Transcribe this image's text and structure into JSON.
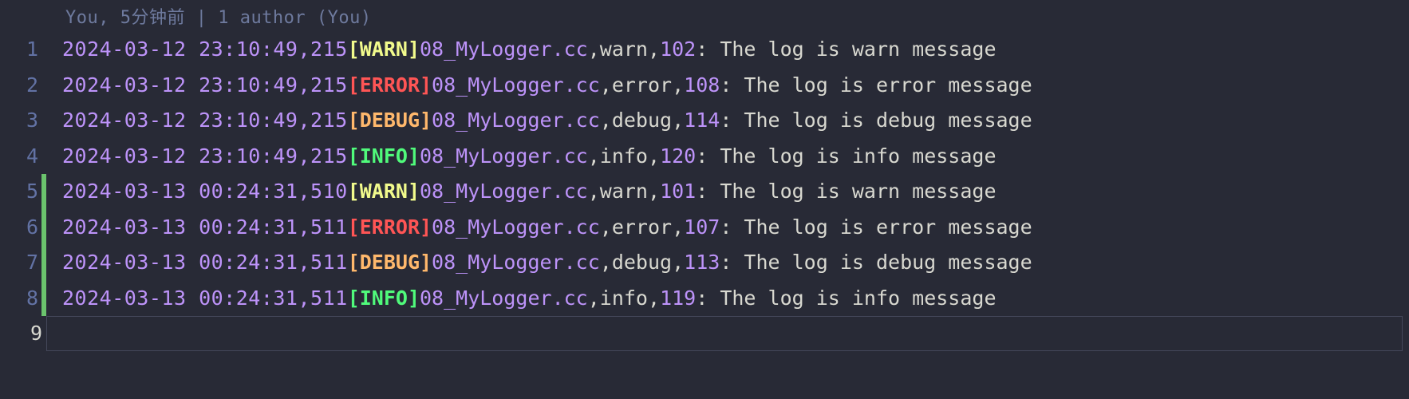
{
  "codelens": "You, 5分钟前 | 1 author (You)",
  "current_line_number": "9",
  "lines": [
    {
      "num": "1",
      "modified": false,
      "date": "2024-03-12 23:10:49,215",
      "level": "WARN",
      "level_class": "tok-warn",
      "file": "08_MyLogger.cc",
      "func": "warn",
      "lineno": "102",
      "msg": "The log is warn message"
    },
    {
      "num": "2",
      "modified": false,
      "date": "2024-03-12 23:10:49,215",
      "level": "ERROR",
      "level_class": "tok-error",
      "file": "08_MyLogger.cc",
      "func": "error",
      "lineno": "108",
      "msg": "The log is error message"
    },
    {
      "num": "3",
      "modified": false,
      "date": "2024-03-12 23:10:49,215",
      "level": "DEBUG",
      "level_class": "tok-debug",
      "file": "08_MyLogger.cc",
      "func": "debug",
      "lineno": "114",
      "msg": "The log is debug message"
    },
    {
      "num": "4",
      "modified": false,
      "date": "2024-03-12 23:10:49,215",
      "level": "INFO",
      "level_class": "tok-info",
      "file": "08_MyLogger.cc",
      "func": "info",
      "lineno": "120",
      "msg": "The log is info message"
    },
    {
      "num": "5",
      "modified": true,
      "date": "2024-03-13 00:24:31,510",
      "level": "WARN",
      "level_class": "tok-warn",
      "file": "08_MyLogger.cc",
      "func": "warn",
      "lineno": "101",
      "msg": "The log is warn message"
    },
    {
      "num": "6",
      "modified": true,
      "date": "2024-03-13 00:24:31,511",
      "level": "ERROR",
      "level_class": "tok-error",
      "file": "08_MyLogger.cc",
      "func": "error",
      "lineno": "107",
      "msg": "The log is error message"
    },
    {
      "num": "7",
      "modified": true,
      "date": "2024-03-13 00:24:31,511",
      "level": "DEBUG",
      "level_class": "tok-debug",
      "file": "08_MyLogger.cc",
      "func": "debug",
      "lineno": "113",
      "msg": "The log is debug message"
    },
    {
      "num": "8",
      "modified": true,
      "date": "2024-03-13 00:24:31,511",
      "level": "INFO",
      "level_class": "tok-info",
      "file": "08_MyLogger.cc",
      "func": "info",
      "lineno": "119",
      "msg": "The log is info message"
    }
  ]
}
